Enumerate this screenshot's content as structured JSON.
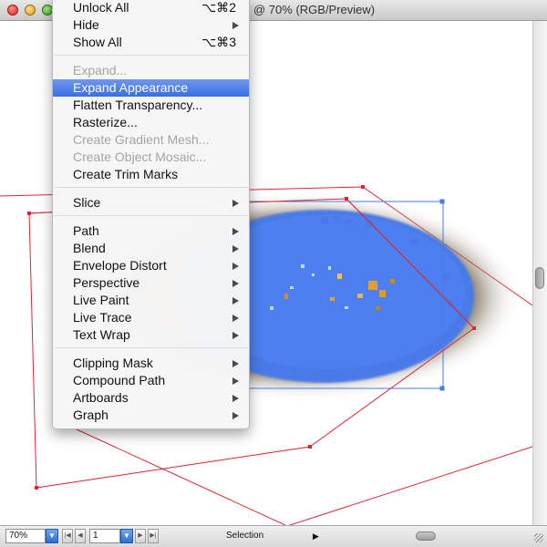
{
  "window": {
    "title": "@ 70% (RGB/Preview)"
  },
  "menu": {
    "items": [
      {
        "label": "Unlock All",
        "shortcut": "⌥⌘2",
        "state": "normal"
      },
      {
        "label": "Hide",
        "shortcut": "",
        "state": "normal",
        "submenu": true
      },
      {
        "label": "Show All",
        "shortcut": "⌥⌘3",
        "state": "normal"
      },
      {
        "label": "Expand...",
        "shortcut": "",
        "state": "disabled"
      },
      {
        "label": "Expand Appearance",
        "shortcut": "",
        "state": "highlighted"
      },
      {
        "label": "Flatten Transparency...",
        "shortcut": "",
        "state": "normal"
      },
      {
        "label": "Rasterize...",
        "shortcut": "",
        "state": "normal"
      },
      {
        "label": "Create Gradient Mesh...",
        "shortcut": "",
        "state": "disabled"
      },
      {
        "label": "Create Object Mosaic...",
        "shortcut": "",
        "state": "disabled"
      },
      {
        "label": "Create Trim Marks",
        "shortcut": "",
        "state": "normal"
      },
      {
        "label": "Slice",
        "shortcut": "",
        "state": "normal",
        "submenu": true
      },
      {
        "label": "Path",
        "shortcut": "",
        "state": "normal",
        "submenu": true
      },
      {
        "label": "Blend",
        "shortcut": "",
        "state": "normal",
        "submenu": true
      },
      {
        "label": "Envelope Distort",
        "shortcut": "",
        "state": "normal",
        "submenu": true
      },
      {
        "label": "Perspective",
        "shortcut": "",
        "state": "normal",
        "submenu": true
      },
      {
        "label": "Live Paint",
        "shortcut": "",
        "state": "normal",
        "submenu": true
      },
      {
        "label": "Live Trace",
        "shortcut": "",
        "state": "normal",
        "submenu": true
      },
      {
        "label": "Text Wrap",
        "shortcut": "",
        "state": "normal",
        "submenu": true
      },
      {
        "label": "Clipping Mask",
        "shortcut": "",
        "state": "normal",
        "submenu": true
      },
      {
        "label": "Compound Path",
        "shortcut": "",
        "state": "normal",
        "submenu": true
      },
      {
        "label": "Artboards",
        "shortcut": "",
        "state": "normal",
        "submenu": true
      },
      {
        "label": "Graph",
        "shortcut": "",
        "state": "normal",
        "submenu": true
      }
    ]
  },
  "statusbar": {
    "zoom": "70%",
    "artboard_number": "1",
    "tool_label": "Selection",
    "tool_arrow": "▶",
    "dropdown_icon": "chevron-down-icon"
  },
  "colors": {
    "menu_highlight": "#3a6ee0",
    "selection_blue": "#4a7ae8",
    "guide_red": "#e0242e",
    "brown_glow": "#8a5a1a"
  }
}
